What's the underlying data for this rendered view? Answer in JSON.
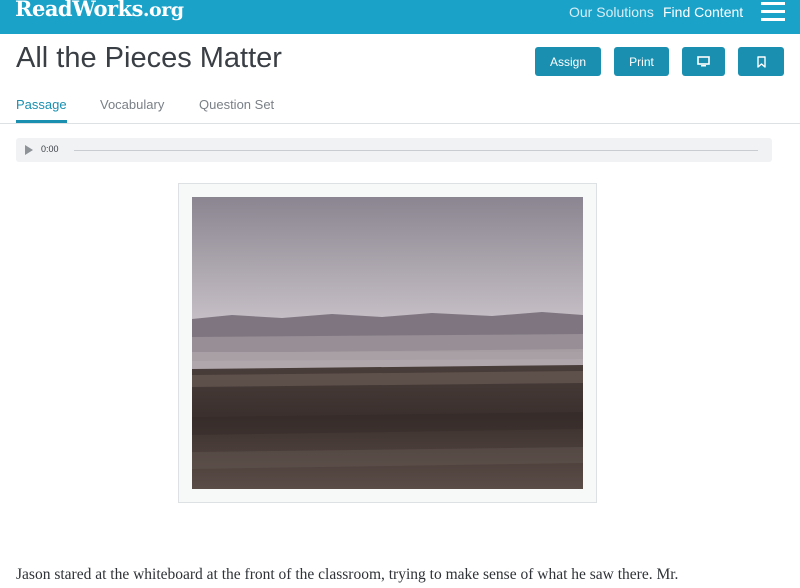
{
  "header": {
    "logo_main": "ReadWorks",
    "logo_tld": ".org",
    "nav": {
      "our_solutions": "Our Solutions",
      "find_content": "Find Content"
    },
    "menu_icon": "hamburger-menu-icon"
  },
  "article": {
    "title": "All the Pieces Matter",
    "actions": {
      "assign": "Assign",
      "print": "Print",
      "present_icon": "monitor-icon",
      "save_icon": "bookmark-icon"
    }
  },
  "tabs": {
    "passage": "Passage",
    "vocabulary": "Vocabulary",
    "question_set": "Question Set",
    "active": "Passage"
  },
  "audio": {
    "time": "0:00",
    "play_icon": "play-icon"
  },
  "figure": {
    "image": "desert-landscape-photo"
  },
  "passage": {
    "first_line": "Jason stared at the whiteboard at the front of the classroom, trying to make sense of what he saw there. Mr."
  },
  "colors": {
    "brand": "#1ba2c9",
    "button": "#1a8fb0",
    "title_text": "#3a3f45",
    "tab_inactive": "#7a8087"
  }
}
